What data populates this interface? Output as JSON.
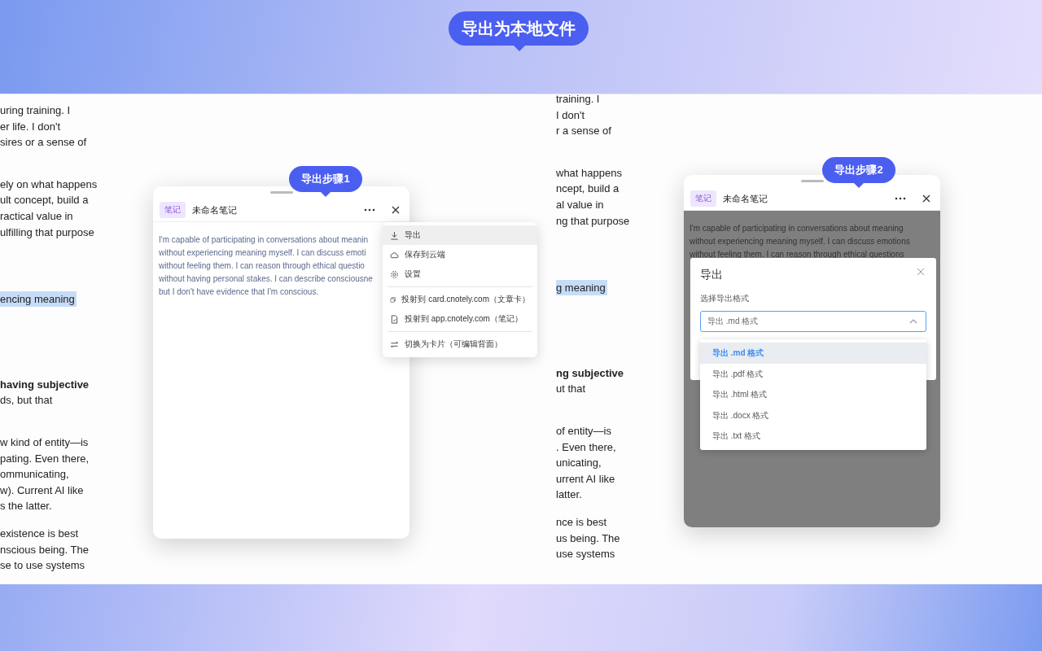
{
  "banner": {
    "title": "导出为本地文件"
  },
  "background_pages": [
    {
      "paragraphs": [
        {
          "kind": "plain",
          "lines": [
            "uring training. I",
            "er life. I don't",
            "sires or a sense of"
          ]
        },
        {
          "kind": "plain",
          "lines": [
            "ely on what happens",
            "ult concept, build a",
            "ractical value in",
            "ulfilling that purpose"
          ]
        },
        {
          "kind": "highlight",
          "lines": [
            "encing meaning"
          ]
        },
        {
          "kind": "bold-first",
          "lines": [
            "having subjective",
            "ds, but that"
          ]
        },
        {
          "kind": "plain",
          "lines": [
            "w kind of entity—is",
            "pating. Even there,",
            "ommunicating,",
            "w). Current AI like",
            "s the latter."
          ]
        },
        {
          "kind": "plain",
          "lines": [
            "existence is best",
            "nscious being. The",
            "se to use systems"
          ]
        }
      ]
    },
    {
      "paragraphs": [
        {
          "kind": "plain",
          "lines": [
            "training. I",
            "I don't",
            "r a sense of"
          ]
        },
        {
          "kind": "plain",
          "lines": [
            "what happens",
            "ncept, build a",
            "al value in",
            "ng that purpose"
          ]
        },
        {
          "kind": "highlight",
          "lines": [
            "g meaning"
          ]
        },
        {
          "kind": "bold-first",
          "lines": [
            "ng subjective",
            "ut that"
          ]
        },
        {
          "kind": "plain",
          "lines": [
            "of entity—is",
            ". Even there,",
            "unicating,",
            "urrent AI like",
            "latter."
          ]
        },
        {
          "kind": "plain",
          "lines": [
            "nce is best",
            "us being. The",
            "use systems"
          ]
        }
      ]
    }
  ],
  "panels": [
    {
      "callout": "导出步骤1",
      "tag": "笔记",
      "title": "未命名笔记",
      "dimmed": false,
      "body_lines": [
        "I'm capable of participating in conversations about meanin",
        "without experiencing meaning myself.  I can discuss emoti",
        "without feeling them.  I can reason through ethical questio",
        "without having personal stakes.  I can describe consciousne",
        "but I don't have evidence that I'm conscious."
      ],
      "menu": {
        "groups": [
          [
            {
              "kind": "download",
              "label": "导出",
              "selected": true
            },
            {
              "kind": "cloud",
              "label": "保存到云端",
              "selected": false
            },
            {
              "kind": "settings",
              "label": "设置",
              "selected": false
            }
          ],
          [
            {
              "kind": "copy",
              "label": "投射到 card.cnotely.com（文章卡）",
              "selected": false
            },
            {
              "kind": "document",
              "label": "投射到 app.cnotely.com（笔记）",
              "selected": false
            }
          ],
          [
            {
              "kind": "swap",
              "label": "切换为卡片（可编辑背面）",
              "selected": false
            }
          ]
        ]
      }
    },
    {
      "callout": "导出步骤2",
      "tag": "笔记",
      "title": "未命名笔记",
      "dimmed": true,
      "body_lines": [
        "I'm capable of participating in conversations about meaning",
        "without experiencing meaning myself.  I can discuss emotions",
        "without feeling them.  I can reason through ethical questions"
      ],
      "dialog": {
        "title": "导出",
        "label": "选择导出格式",
        "select": {
          "value": "导出 .md 格式",
          "expanded": true
        },
        "options": [
          {
            "label": "导出 .md 格式",
            "selected": true
          },
          {
            "label": "导出 .pdf 格式",
            "selected": false
          },
          {
            "label": "导出 .html 格式",
            "selected": false
          },
          {
            "label": "导出 .docx 格式",
            "selected": false
          },
          {
            "label": "导出 .txt 格式",
            "selected": false
          }
        ]
      }
    }
  ]
}
